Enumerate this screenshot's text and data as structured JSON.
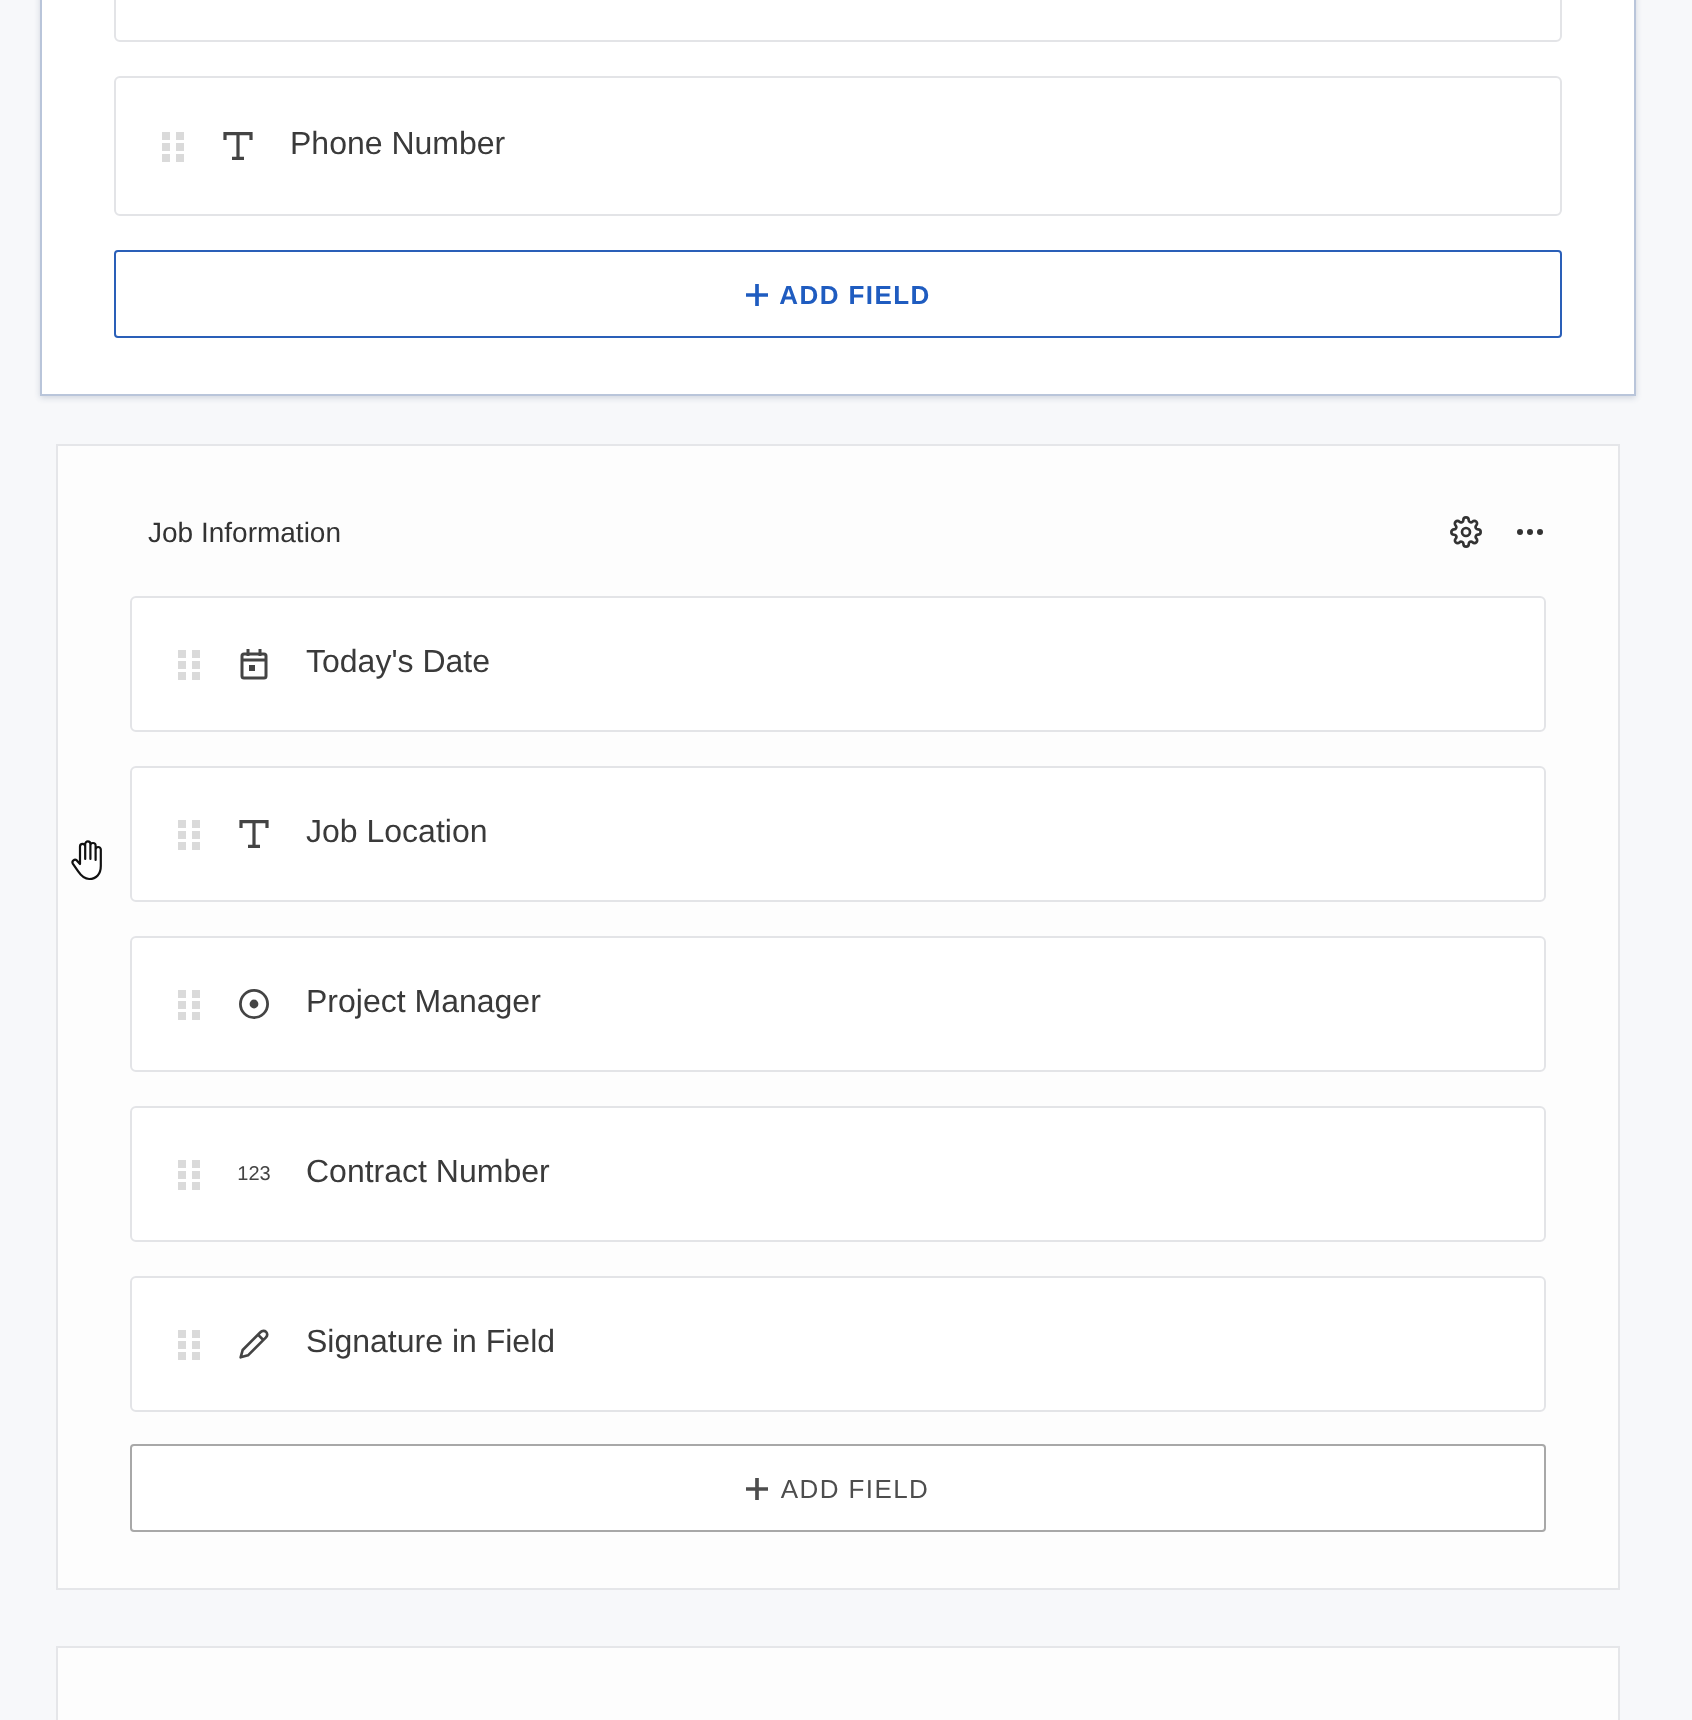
{
  "sections": [
    {
      "selected": true,
      "fields": [
        {
          "kind": "clipped"
        },
        {
          "kind": "text",
          "label": "Phone Number"
        }
      ],
      "add_button": "ADD FIELD"
    },
    {
      "title": "Job Information",
      "selected": false,
      "fields": [
        {
          "kind": "date",
          "label": "Today's Date"
        },
        {
          "kind": "text",
          "label": "Job Location"
        },
        {
          "kind": "choice",
          "label": "Project Manager"
        },
        {
          "kind": "number",
          "icon_text": "123",
          "label": "Contract Number"
        },
        {
          "kind": "signature",
          "label": "Signature in Field"
        }
      ],
      "add_button": "ADD FIELD"
    },
    {
      "selected": false
    }
  ],
  "cursor": {
    "kind": "hand"
  }
}
